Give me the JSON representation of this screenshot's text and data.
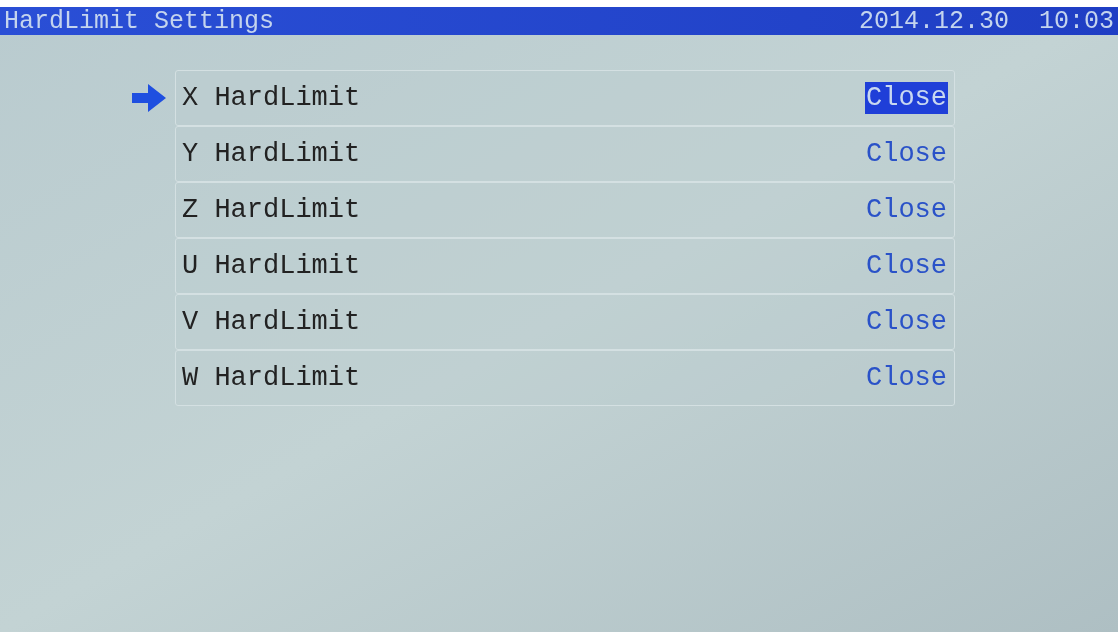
{
  "header": {
    "title": "HardLimit Settings",
    "date": "2014.12.30",
    "time": "10:03"
  },
  "rows": [
    {
      "label": "X HardLimit",
      "value": "Close",
      "selected": true
    },
    {
      "label": "Y HardLimit",
      "value": "Close",
      "selected": false
    },
    {
      "label": "Z HardLimit",
      "value": "Close",
      "selected": false
    },
    {
      "label": "U HardLimit",
      "value": "Close",
      "selected": false
    },
    {
      "label": "V HardLimit",
      "value": "Close",
      "selected": false
    },
    {
      "label": "W HardLimit",
      "value": "Close",
      "selected": false
    }
  ]
}
